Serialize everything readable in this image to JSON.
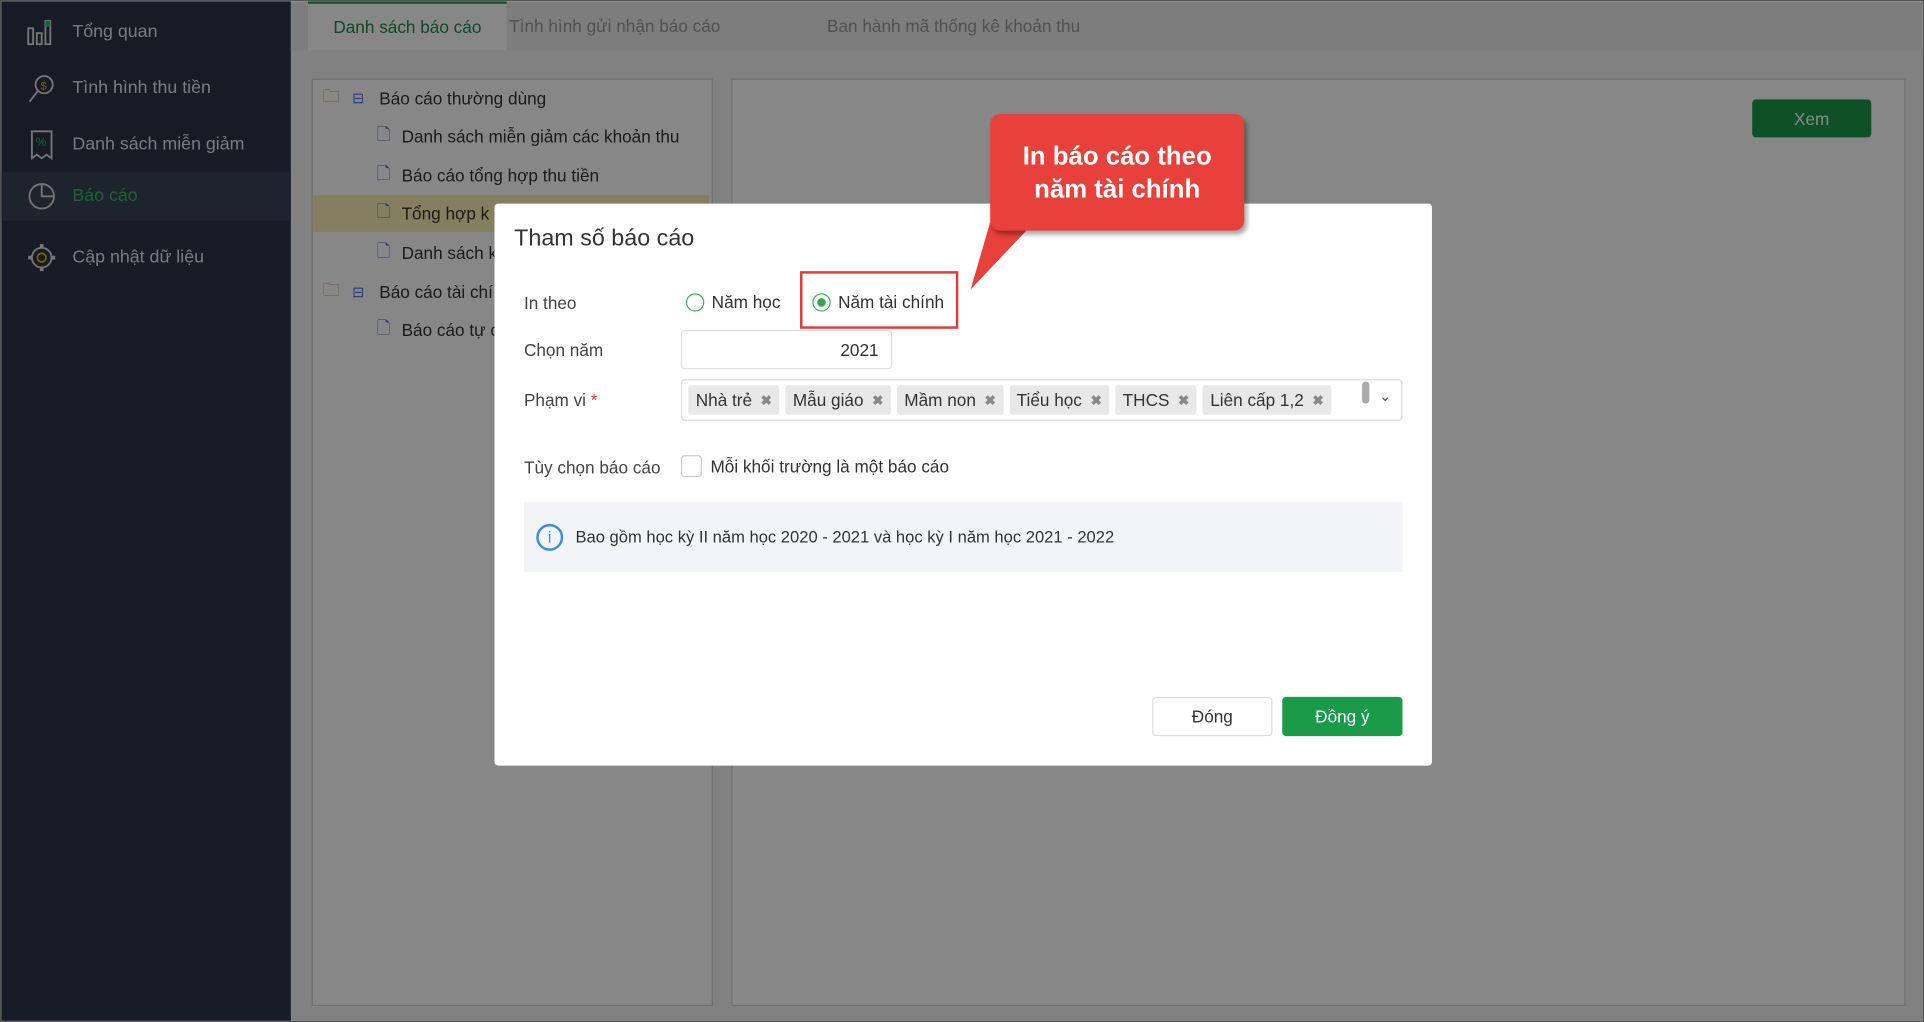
{
  "sidebar": {
    "items": [
      {
        "label": "Tổng quan",
        "icon": "bar-chart-icon"
      },
      {
        "label": "Tình hình thu tiền",
        "icon": "magnifier-dollar-icon"
      },
      {
        "label": "Danh sách miễn giảm",
        "icon": "percent-receipt-icon"
      },
      {
        "label": "Báo cáo",
        "icon": "pie-chart-icon",
        "active": true
      },
      {
        "label": "Cập nhật dữ liệu",
        "icon": "gear-icon"
      }
    ]
  },
  "tabs": [
    "Danh sách báo cáo",
    "Tình hình gửi nhận báo cáo",
    "Ban hành mã thống kê khoản thu"
  ],
  "tree": {
    "group1": "Báo cáo thường dùng",
    "group1_items": [
      "Danh sách miễn giảm các khoản thu",
      "Báo cáo tổng hợp thu tiền",
      "Tổng hợp k",
      "Danh sách k"
    ],
    "group2": "Báo cáo tài chí",
    "group2_items": [
      "Báo cáo tự c"
    ]
  },
  "view_button": "Xem",
  "modal": {
    "title": "Tham số báo cáo",
    "in_theo_label": "In theo",
    "radio_options": [
      "Năm học",
      "Năm tài chính"
    ],
    "radio_selected": "Năm tài chính",
    "chon_nam_label": "Chọn năm",
    "chon_nam_value": "2021",
    "pham_vi_label": "Phạm vi",
    "required_mark": "*",
    "pham_vi_tags": [
      "Nhà trẻ",
      "Mẫu giáo",
      "Mầm non",
      "Tiểu học",
      "THCS",
      "Liên cấp 1,2"
    ],
    "tuy_chon_label": "Tùy chọn báo cáo",
    "checkbox_label": "Mỗi khối trường là một báo cáo",
    "checkbox_checked": false,
    "info_text": "Bao gồm học kỳ II năm học 2020 - 2021 và học kỳ I năm học 2021 - 2022",
    "close_button": "Đóng",
    "ok_button": "Đồng ý"
  },
  "callout": {
    "line1": "In báo cáo theo",
    "line2": "năm tài chính"
  },
  "colors": {
    "accent": "#1b9a4a",
    "callout": "#e8403a",
    "highlight": "#e53935"
  }
}
